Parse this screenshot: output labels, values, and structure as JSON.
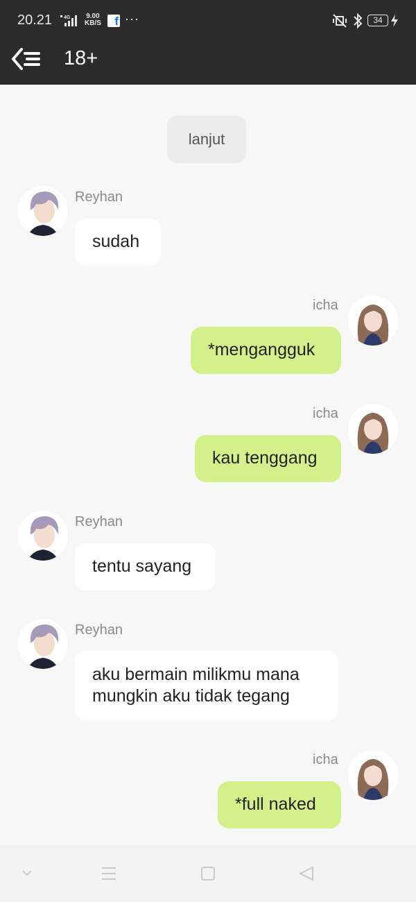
{
  "status_bar": {
    "time": "20.21",
    "network": "4G",
    "speed_value": "9.00",
    "speed_unit": "KB/S",
    "more": "···",
    "battery": "34"
  },
  "header": {
    "back_icon": "back-menu-icon",
    "title": "18+"
  },
  "chat": {
    "system_label": "lanjut",
    "messages": [
      {
        "sender": "Reyhan",
        "side": "left",
        "text": "sudah"
      },
      {
        "sender": "icha",
        "side": "right",
        "text": "*mengangguk"
      },
      {
        "sender": "icha",
        "side": "right",
        "text": "kau tenggang"
      },
      {
        "sender": "Reyhan",
        "side": "left",
        "text": "tentu sayang"
      },
      {
        "sender": "Reyhan",
        "side": "left",
        "text": "aku bermain milikmu mana mungkin aku tidak tegang"
      },
      {
        "sender": "icha",
        "side": "right",
        "text": "*full naked"
      }
    ]
  },
  "colors": {
    "header_bg": "#2c2c2c",
    "right_bubble": "#d4f08b",
    "left_bubble": "#ffffff",
    "chat_bg": "#f7f7f7"
  },
  "nav_bar": {
    "icons": [
      "chevron-down-icon",
      "menu-icon",
      "home-square-icon",
      "back-triangle-icon"
    ]
  }
}
